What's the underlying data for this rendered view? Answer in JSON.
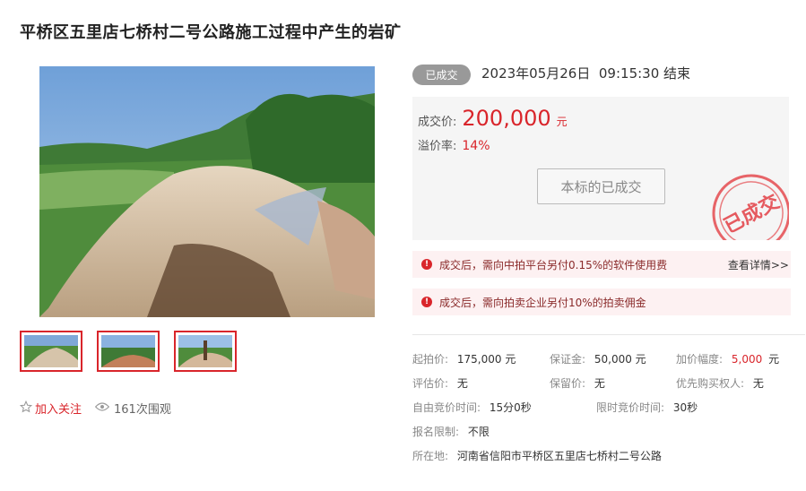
{
  "title": "平桥区五里店七桥村二号公路施工过程中产生的岩矿",
  "gallery": {
    "main_image": "pile-of-rock-ore-photo",
    "thumbnails": [
      "rock-pile-thumb-1",
      "rock-pile-thumb-2",
      "rock-pile-thumb-3"
    ]
  },
  "actions": {
    "follow_icon": "star-icon",
    "follow_label": "加入关注",
    "views_icon": "eye-icon",
    "views_label": "161次围观"
  },
  "status": {
    "badge": "已成交",
    "end_time": "2023年05月26日  09:15:30 结束"
  },
  "price": {
    "deal_label": "成交价:",
    "deal_value": "200,000",
    "deal_unit": "元",
    "premium_label": "溢价率:",
    "premium_value": "14%",
    "sold_button": "本标的已成交",
    "stamp_text": "已成交"
  },
  "notices": [
    {
      "icon": "exclamation-icon",
      "text": "成交后，需向中拍平台另付0.15%的软件使用费",
      "link": "查看详情>>"
    },
    {
      "icon": "exclamation-icon",
      "text": "成交后，需向拍卖企业另付10%的拍卖佣金"
    }
  ],
  "details": {
    "start_price_label": "起拍价:",
    "start_price": "175,000 元",
    "deposit_label": "保证金:",
    "deposit": "50,000 元",
    "increment_label": "加价幅度:",
    "increment": "5,000",
    "increment_unit": "元",
    "appraisal_label": "评估价:",
    "appraisal": "无",
    "reserve_label": "保留价:",
    "reserve": "无",
    "priority_label": "优先购买权人:",
    "priority": "无",
    "free_bid_label": "自由竞价时间:",
    "free_bid": "15分0秒",
    "limited_bid_label": "限时竞价时间:",
    "limited_bid": "30秒",
    "signup_label": "报名限制:",
    "signup": "不限",
    "location_label": "所在地:",
    "location": "河南省信阳市平桥区五里店七桥村二号公路"
  },
  "colors": {
    "accent": "#d9252b",
    "badge_gray": "#999999",
    "price_bg": "#f5f5f5",
    "notice_bg": "#fdf1f2"
  }
}
